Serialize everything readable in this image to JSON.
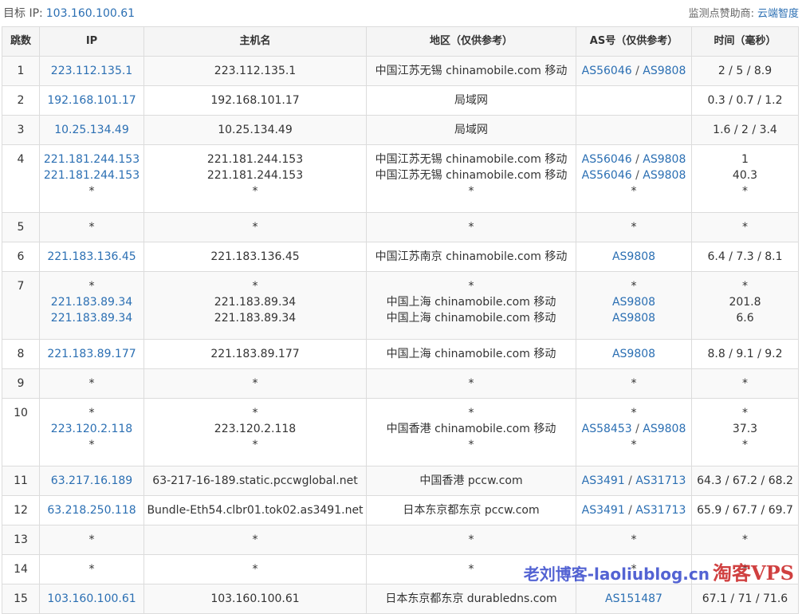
{
  "header": {
    "target_label": "目标 IP:",
    "target_ip": "103.160.100.61",
    "sponsor_label": "监测点赞助商:",
    "sponsor_name": "云端智度"
  },
  "columns": [
    "跳数",
    "IP",
    "主机名",
    "地区（仅供参考）",
    "AS号（仅供参考）",
    "时间（毫秒）"
  ],
  "rows": [
    {
      "hop": "1",
      "ips": [
        "223.112.135.1"
      ],
      "hosts": [
        "223.112.135.1"
      ],
      "regions": [
        "中国江苏无锡 chinamobile.com 移动"
      ],
      "asns": [
        [
          "AS56046",
          "AS9808"
        ]
      ],
      "times": [
        "2 / 5 / 8.9"
      ]
    },
    {
      "hop": "2",
      "ips": [
        "192.168.101.17"
      ],
      "hosts": [
        "192.168.101.17"
      ],
      "regions": [
        "局域网"
      ],
      "asns": [
        []
      ],
      "times": [
        "0.3 / 0.7 / 1.2"
      ]
    },
    {
      "hop": "3",
      "ips": [
        "10.25.134.49"
      ],
      "hosts": [
        "10.25.134.49"
      ],
      "regions": [
        "局域网"
      ],
      "asns": [
        []
      ],
      "times": [
        "1.6 / 2 / 3.4"
      ]
    },
    {
      "hop": "4",
      "ips": [
        "221.181.244.153",
        "221.181.244.153",
        "*"
      ],
      "hosts": [
        "221.181.244.153",
        "221.181.244.153",
        "*"
      ],
      "regions": [
        "中国江苏无锡 chinamobile.com 移动",
        "中国江苏无锡 chinamobile.com 移动",
        "*"
      ],
      "asns": [
        [
          "AS56046",
          "AS9808"
        ],
        [
          "AS56046",
          "AS9808"
        ],
        [
          "*"
        ]
      ],
      "times": [
        "1",
        "40.3",
        "*"
      ]
    },
    {
      "hop": "5",
      "ips": [
        "*"
      ],
      "hosts": [
        "*"
      ],
      "regions": [
        "*"
      ],
      "asns": [
        [
          "*"
        ]
      ],
      "times": [
        "*"
      ]
    },
    {
      "hop": "6",
      "ips": [
        "221.183.136.45"
      ],
      "hosts": [
        "221.183.136.45"
      ],
      "regions": [
        "中国江苏南京 chinamobile.com 移动"
      ],
      "asns": [
        [
          "AS9808"
        ]
      ],
      "times": [
        "6.4 / 7.3 / 8.1"
      ]
    },
    {
      "hop": "7",
      "ips": [
        "*",
        "221.183.89.34",
        "221.183.89.34"
      ],
      "hosts": [
        "*",
        "221.183.89.34",
        "221.183.89.34"
      ],
      "regions": [
        "*",
        "中国上海 chinamobile.com 移动",
        "中国上海 chinamobile.com 移动"
      ],
      "asns": [
        [
          "*"
        ],
        [
          "AS9808"
        ],
        [
          "AS9808"
        ]
      ],
      "times": [
        "*",
        "201.8",
        "6.6"
      ]
    },
    {
      "hop": "8",
      "ips": [
        "221.183.89.177"
      ],
      "hosts": [
        "221.183.89.177"
      ],
      "regions": [
        "中国上海 chinamobile.com 移动"
      ],
      "asns": [
        [
          "AS9808"
        ]
      ],
      "times": [
        "8.8 / 9.1 / 9.2"
      ]
    },
    {
      "hop": "9",
      "ips": [
        "*"
      ],
      "hosts": [
        "*"
      ],
      "regions": [
        "*"
      ],
      "asns": [
        [
          "*"
        ]
      ],
      "times": [
        "*"
      ]
    },
    {
      "hop": "10",
      "ips": [
        "*",
        "223.120.2.118",
        "*"
      ],
      "hosts": [
        "*",
        "223.120.2.118",
        "*"
      ],
      "regions": [
        "*",
        "中国香港 chinamobile.com 移动",
        "*"
      ],
      "asns": [
        [
          "*"
        ],
        [
          "AS58453",
          "AS9808"
        ],
        [
          "*"
        ]
      ],
      "times": [
        "*",
        "37.3",
        "*"
      ]
    },
    {
      "hop": "11",
      "ips": [
        "63.217.16.189"
      ],
      "hosts": [
        "63-217-16-189.static.pccwglobal.net"
      ],
      "regions": [
        "中国香港 pccw.com"
      ],
      "asns": [
        [
          "AS3491",
          "AS31713"
        ]
      ],
      "times": [
        "64.3 / 67.2 / 68.2"
      ]
    },
    {
      "hop": "12",
      "ips": [
        "63.218.250.118"
      ],
      "hosts": [
        "Bundle-Eth54.clbr01.tok02.as3491.net"
      ],
      "regions": [
        "日本东京都东京 pccw.com"
      ],
      "asns": [
        [
          "AS3491",
          "AS31713"
        ]
      ],
      "times": [
        "65.9 / 67.7 / 69.7"
      ]
    },
    {
      "hop": "13",
      "ips": [
        "*"
      ],
      "hosts": [
        "*"
      ],
      "regions": [
        "*"
      ],
      "asns": [
        [
          "*"
        ]
      ],
      "times": [
        "*"
      ]
    },
    {
      "hop": "14",
      "ips": [
        "*"
      ],
      "hosts": [
        "*"
      ],
      "regions": [
        "*"
      ],
      "asns": [
        [
          "*"
        ]
      ],
      "times": [
        "*"
      ]
    },
    {
      "hop": "15",
      "ips": [
        "103.160.100.61"
      ],
      "hosts": [
        "103.160.100.61"
      ],
      "regions": [
        "日本东京都东京 durabledns.com"
      ],
      "asns": [
        [
          "AS151487"
        ]
      ],
      "times": [
        "67.1 / 71 / 71.6"
      ]
    }
  ],
  "watermark": {
    "text": "老刘博客-laoliublog.cn",
    "brand": "淘客VPS"
  }
}
